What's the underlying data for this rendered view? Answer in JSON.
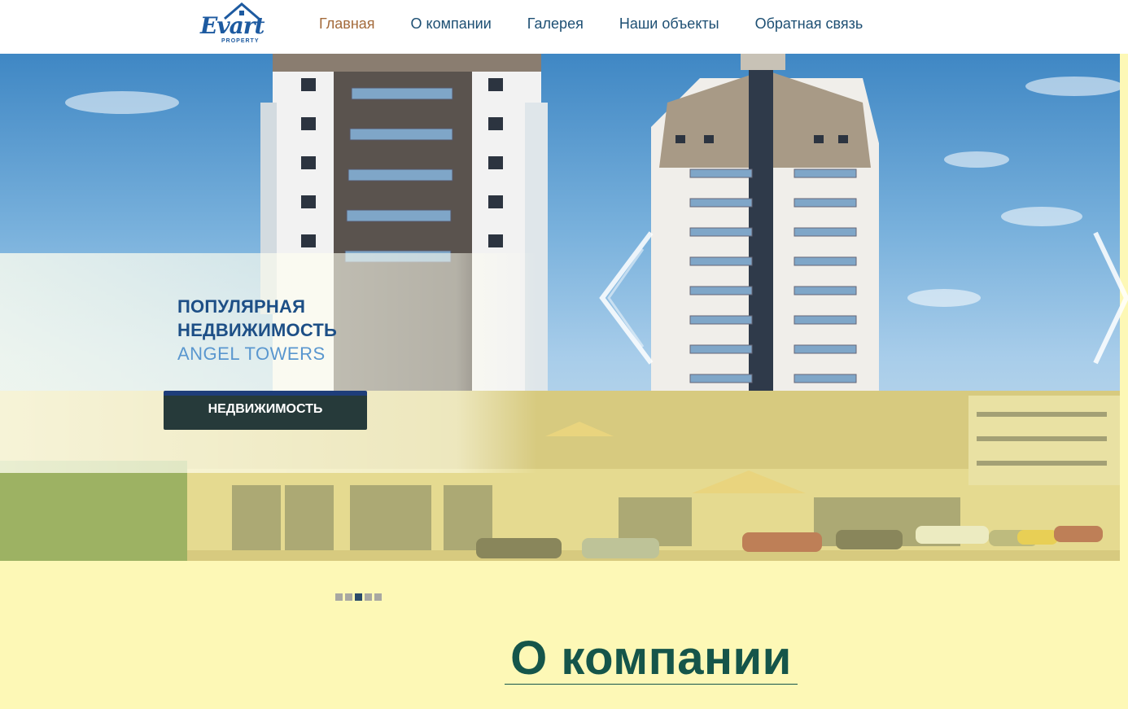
{
  "logo": {
    "word": "Evart",
    "sub": "PROPERTY",
    "icon": "house-roof-icon"
  },
  "nav": {
    "items": [
      {
        "label": "Главная",
        "active": true
      },
      {
        "label": "О компании",
        "active": false
      },
      {
        "label": "Галерея",
        "active": false
      },
      {
        "label": "Наши объекты",
        "active": false
      },
      {
        "label": "Обратная связь",
        "active": false
      }
    ]
  },
  "hero": {
    "title_line1": "ПОПУЛЯРНАЯ",
    "title_line2": "НЕДВИЖИМОСТЬ",
    "subtitle": "ANGEL TOWERS",
    "cta_label": "НЕДВИЖИМОСТЬ",
    "prev_icon": "chevron-left-icon",
    "next_icon": "chevron-right-icon"
  },
  "slider": {
    "count": 5,
    "active_index": 2
  },
  "about": {
    "title": "О компании"
  },
  "colors": {
    "nav_text": "#1d4f73",
    "nav_active": "#a36a3a",
    "accent_blue": "#1d4f86",
    "cta_bg": "#263a3a",
    "page_bg": "#fdf8b6",
    "about_title": "#15554a"
  }
}
